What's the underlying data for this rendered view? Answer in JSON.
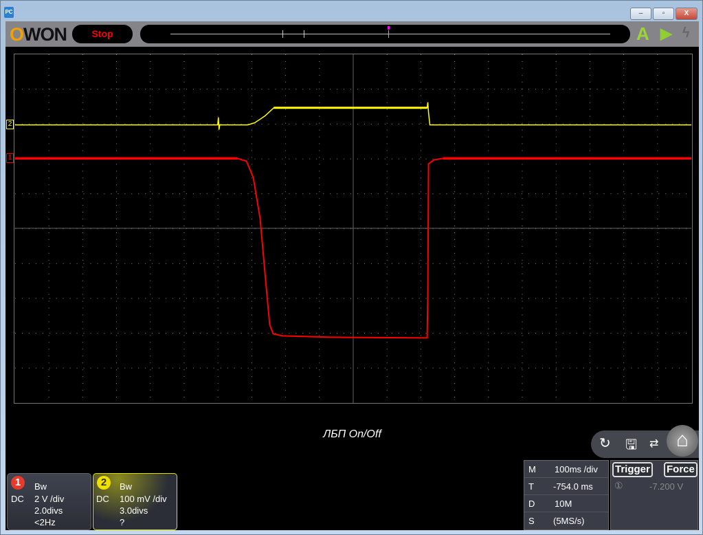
{
  "window": {
    "app_icon": "PC",
    "minimize": "–",
    "restore": "▫",
    "close": "X"
  },
  "toolbar": {
    "logo_prefix": "O",
    "logo_rest": "WON",
    "run_state": "Stop",
    "auto_icon": "A",
    "run_icon": "play-icon",
    "force_icon": "lightning-icon"
  },
  "screen": {
    "caption": "ЛБП  On/Off",
    "ch1_marker": "1",
    "ch2_marker": "2",
    "colors": {
      "ch1": "#ff0000",
      "ch2": "#ffff00",
      "grid": "#888888"
    }
  },
  "channels": [
    {
      "number": "1",
      "bw": "Bw",
      "coupling": "DC",
      "scale": "2 V /div",
      "position": "2.0divs",
      "freq": "<2Hz",
      "color": "#e53a2e"
    },
    {
      "number": "2",
      "bw": "Bw",
      "coupling": "DC",
      "scale": "100 mV /div",
      "position": "3.0divs",
      "freq": "?",
      "color": "#f0e000"
    }
  ],
  "timebase": [
    {
      "key": "M",
      "value": "100ms /div"
    },
    {
      "key": "T",
      "value": "-754.0 ms"
    },
    {
      "key": "D",
      "value": "10M"
    },
    {
      "key": "S",
      "value": "(5MS/s)"
    }
  ],
  "trigger": {
    "trigger_label": "Trigger",
    "force_label": "Force",
    "source": "①",
    "level": "-7.200 V"
  },
  "tools": [
    "auto-scale-icon",
    "save-icon",
    "swap-icon",
    "home-icon"
  ]
}
